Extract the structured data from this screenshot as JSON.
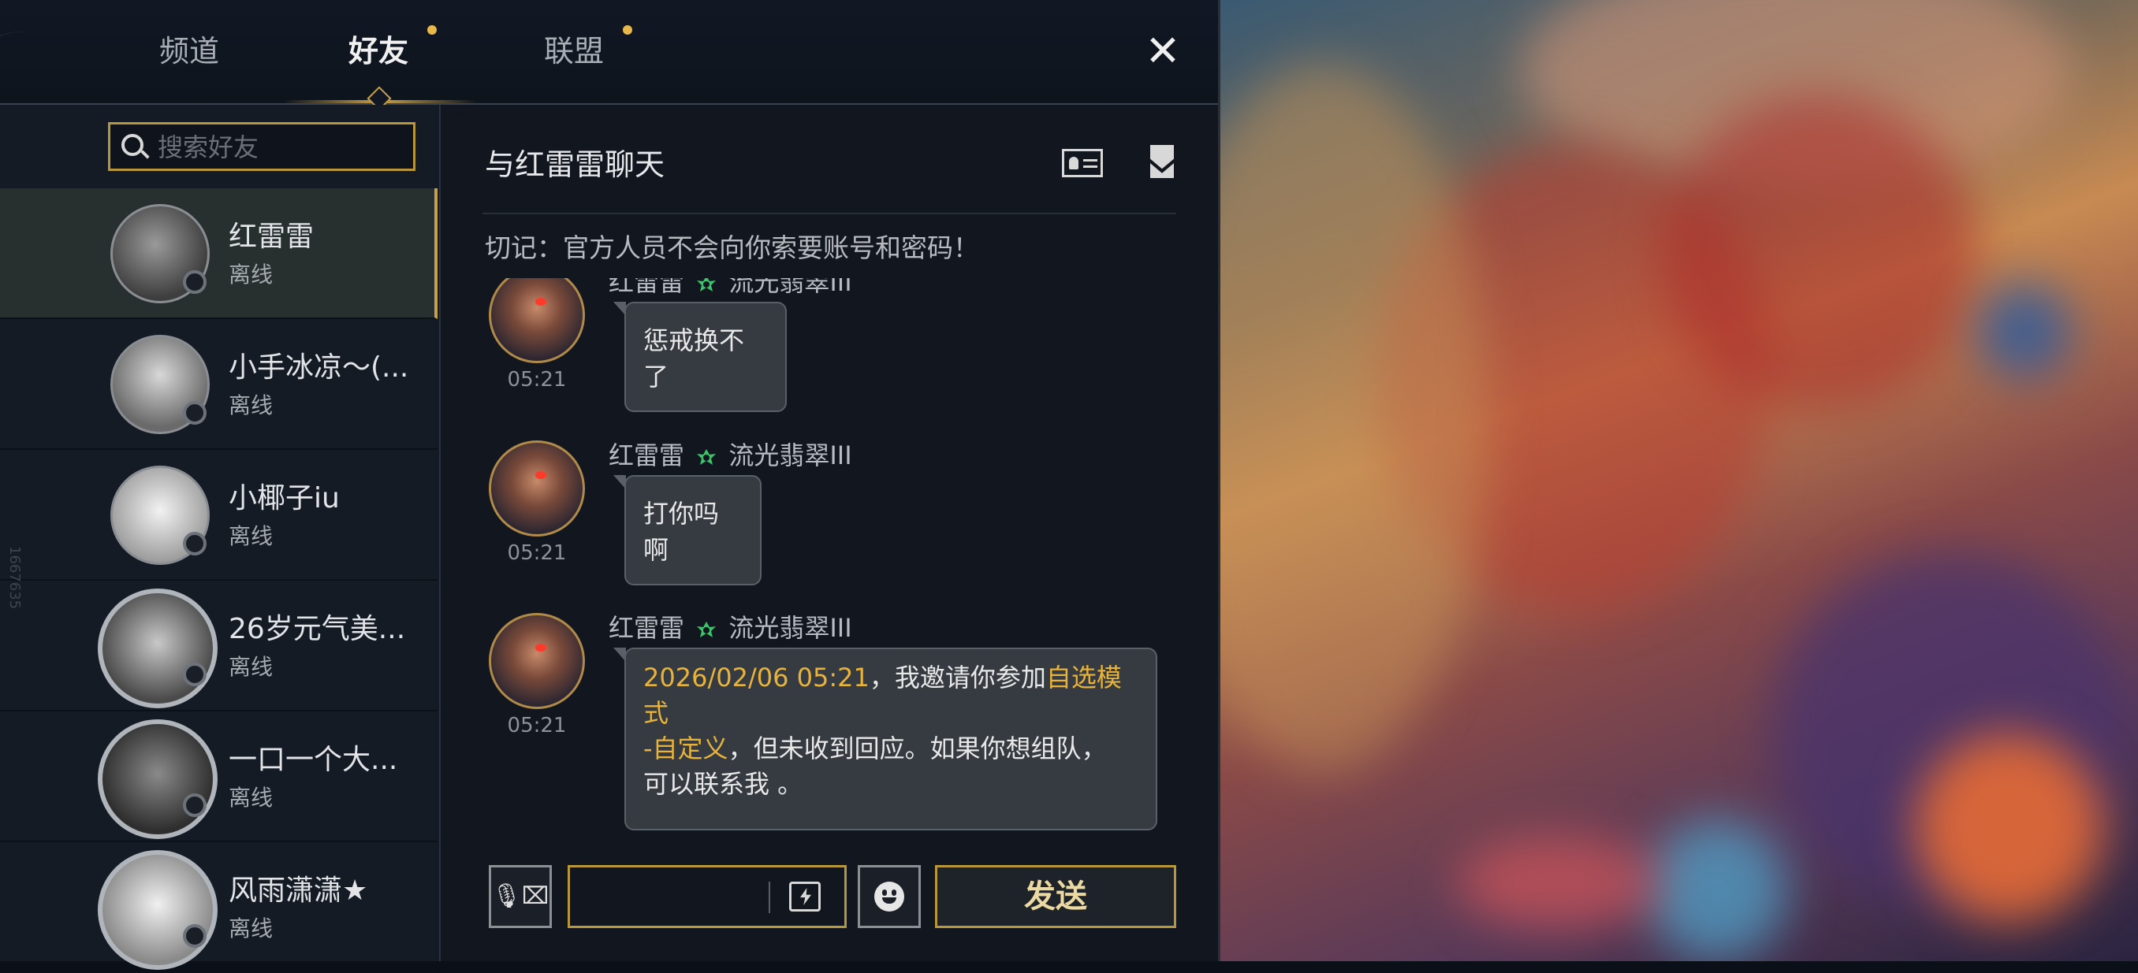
{
  "tabs": [
    {
      "label": "频道",
      "active": false,
      "dot": false
    },
    {
      "label": "好友",
      "active": true,
      "dot": true
    },
    {
      "label": "联盟",
      "active": false,
      "dot": true
    }
  ],
  "close_label": "✕",
  "search": {
    "placeholder": "搜索好友",
    "value": ""
  },
  "friends": [
    {
      "name": "红雷雷",
      "status": "离线",
      "selected": true
    },
    {
      "name": "小手冰凉～(...",
      "status": "离线"
    },
    {
      "name": "小椰子iu",
      "status": "离线"
    },
    {
      "name": "26岁元气美...",
      "status": "离线"
    },
    {
      "name": "一口一个大...",
      "status": "离线"
    },
    {
      "name": "风雨潇潇★",
      "status": "离线"
    }
  ],
  "side_id": "1667635",
  "chat": {
    "title": "与红雷雷聊天",
    "warning": "切记：官方人员不会向你索要账号和密码！",
    "messages": [
      {
        "sender": "红雷雷",
        "rank": "流光翡翠III",
        "time": "05:21",
        "text": "惩戒换不了"
      },
      {
        "sender": "红雷雷",
        "rank": "流光翡翠III",
        "time": "05:21",
        "text": "打你吗啊"
      },
      {
        "sender": "红雷雷",
        "rank": "流光翡翠III",
        "time": "05:21",
        "invite": {
          "date": "2026/02/06 05:21",
          "t1": "，我邀请你参加",
          "mode1": "自选模式",
          "mode2": "-自定义",
          "t2": "，但未收到回应。如果你想组队，",
          "t3": "可以联系我 。"
        }
      }
    ],
    "input": {
      "value": "",
      "placeholder": ""
    },
    "send_label": "发送",
    "voice_label": "🎙⌧"
  },
  "icons": [
    "close-icon",
    "search-icon",
    "profile-card-icon",
    "mail-icon",
    "rank-emblem-icon",
    "voice-to-text-icon",
    "quick-message-icon",
    "emoji-icon"
  ],
  "colors": {
    "accent_gold": "#b8963c",
    "highlight": "#e8b33a",
    "rank_green": "#3cc46a"
  }
}
